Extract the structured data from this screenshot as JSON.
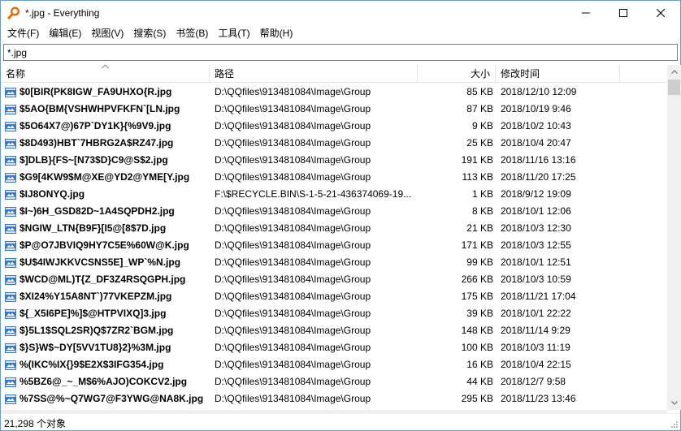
{
  "window": {
    "title": "*.jpg - Everything"
  },
  "menu": [
    "文件(F)",
    "编辑(E)",
    "视图(V)",
    "搜索(S)",
    "书签(B)",
    "工具(T)",
    "帮助(H)"
  ],
  "search": {
    "value": "*.jpg"
  },
  "columns": {
    "name": "名称",
    "path": "路径",
    "size": "大小",
    "modified": "修改时间"
  },
  "rows": [
    {
      "name": "$0[BIR(PK8IGW_FA9UHXO{R.jpg",
      "path": "D:\\QQfiles\\913481084\\Image\\Group",
      "size": "85 KB",
      "modified": "2018/12/10 12:09"
    },
    {
      "name": "$5AO{BM{VSHWHPVFKFN`[LN.jpg",
      "path": "D:\\QQfiles\\913481084\\Image\\Group",
      "size": "87 KB",
      "modified": "2018/10/19 9:46"
    },
    {
      "name": "$5O64X7@)67P`DY1K}{%9V9.jpg",
      "path": "D:\\QQfiles\\913481084\\Image\\Group",
      "size": "9 KB",
      "modified": "2018/10/2 10:43"
    },
    {
      "name": "$8D493)HBT`7HBRG2A$RZ47.jpg",
      "path": "D:\\QQfiles\\913481084\\Image\\Group",
      "size": "25 KB",
      "modified": "2018/10/4 20:47"
    },
    {
      "name": "$]DLB}{FS~[N73$D}C9@S$2.jpg",
      "path": "D:\\QQfiles\\913481084\\Image\\Group",
      "size": "191 KB",
      "modified": "2018/11/16 13:16"
    },
    {
      "name": "$G9[4KW9$M@XE@YD2@YME[Y.jpg",
      "path": "D:\\QQfiles\\913481084\\Image\\Group",
      "size": "113 KB",
      "modified": "2018/11/20 17:25"
    },
    {
      "name": "$IJ8ONYQ.jpg",
      "path": "F:\\$RECYCLE.BIN\\S-1-5-21-436374069-19...",
      "size": "1 KB",
      "modified": "2018/9/12 19:09"
    },
    {
      "name": "$I~)6H_GSD82D~1A4SQPDH2.jpg",
      "path": "D:\\QQfiles\\913481084\\Image\\Group",
      "size": "8 KB",
      "modified": "2018/10/1 12:06"
    },
    {
      "name": "$NGIW_LTN{B9F}[I5@[8$7D.jpg",
      "path": "D:\\QQfiles\\913481084\\Image\\Group",
      "size": "21 KB",
      "modified": "2018/10/3 12:30"
    },
    {
      "name": "$P@O7JBVIQ9HY7C5E%60W@K.jpg",
      "path": "D:\\QQfiles\\913481084\\Image\\Group",
      "size": "171 KB",
      "modified": "2018/10/3 12:55"
    },
    {
      "name": "$U$4IWJKKVCSNS5E]_WP`%N.jpg",
      "path": "D:\\QQfiles\\913481084\\Image\\Group",
      "size": "99 KB",
      "modified": "2018/10/1 12:51"
    },
    {
      "name": "$WCD@ML)T{Z_DF3Z4RSQGPH.jpg",
      "path": "D:\\QQfiles\\913481084\\Image\\Group",
      "size": "266 KB",
      "modified": "2018/10/3 10:59"
    },
    {
      "name": "$XI24%Y15A8NT`)77VKEPZM.jpg",
      "path": "D:\\QQfiles\\913481084\\Image\\Group",
      "size": "175 KB",
      "modified": "2018/11/21 17:04"
    },
    {
      "name": "${_X5I6PE]%]$@HTPVIXQ]3.jpg",
      "path": "D:\\QQfiles\\913481084\\Image\\Group",
      "size": "39 KB",
      "modified": "2018/10/1 22:22"
    },
    {
      "name": "$}5L1$SQL2SR)Q$7ZR2`BGM.jpg",
      "path": "D:\\QQfiles\\913481084\\Image\\Group",
      "size": "148 KB",
      "modified": "2018/11/14 9:29"
    },
    {
      "name": "$}S}W$~DY[5VV1TU8}2}%3M.jpg",
      "path": "D:\\QQfiles\\913481084\\Image\\Group",
      "size": "100 KB",
      "modified": "2018/10/3 11:19"
    },
    {
      "name": "%(IKC%IX{}9$E2X$3IFG354.jpg",
      "path": "D:\\QQfiles\\913481084\\Image\\Group",
      "size": "16 KB",
      "modified": "2018/10/4 22:15"
    },
    {
      "name": "%5BZ6@_~_M$6%AJO)COKCV2.jpg",
      "path": "D:\\QQfiles\\913481084\\Image\\Group",
      "size": "44 KB",
      "modified": "2018/12/7 9:58"
    },
    {
      "name": "%7SS@%~Q7WG7@F3YWG@NA8K.jpg",
      "path": "D:\\QQfiles\\913481084\\Image\\Group",
      "size": "295 KB",
      "modified": "2018/11/23 13:46"
    }
  ],
  "status": {
    "text": "21,298 个对象"
  },
  "icons": {
    "app": "magnifier-icon",
    "file": "jpg-file-icon"
  },
  "colors": {
    "app_icon_handle": "#e36c09",
    "file_icon_blue": "#3a78c9"
  }
}
